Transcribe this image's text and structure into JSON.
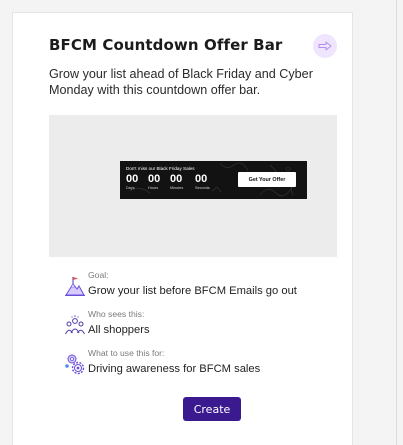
{
  "card": {
    "title": "BFCM  Countdown Offer Bar",
    "description": "Grow your list ahead of Black Friday and Cyber Monday with this countdown offer bar.",
    "next_icon": "arrow-right-icon"
  },
  "preview": {
    "headline": "Don't miss our Black Friday Sales",
    "counters": [
      {
        "value": "00",
        "unit": "Days"
      },
      {
        "value": "00",
        "unit": "Hours"
      },
      {
        "value": "00",
        "unit": "Minutes"
      },
      {
        "value": "00",
        "unit": "Seconds"
      }
    ],
    "cta": "Get Your Offer"
  },
  "details": [
    {
      "label": "Goal:",
      "value": "Grow your list before BFCM Emails go out",
      "icon": "mountain-flag-icon"
    },
    {
      "label": "Who sees this:",
      "value": "All shoppers",
      "icon": "people-group-icon"
    },
    {
      "label": "What to use this for:",
      "value": "Driving awareness for BFCM sales",
      "icon": "gears-icon"
    }
  ],
  "actions": {
    "create_label": "Create"
  },
  "colors": {
    "primary": "#3b1a8f",
    "accent_light": "#f0e5ff",
    "icon_purple": "#6b4fd8"
  }
}
